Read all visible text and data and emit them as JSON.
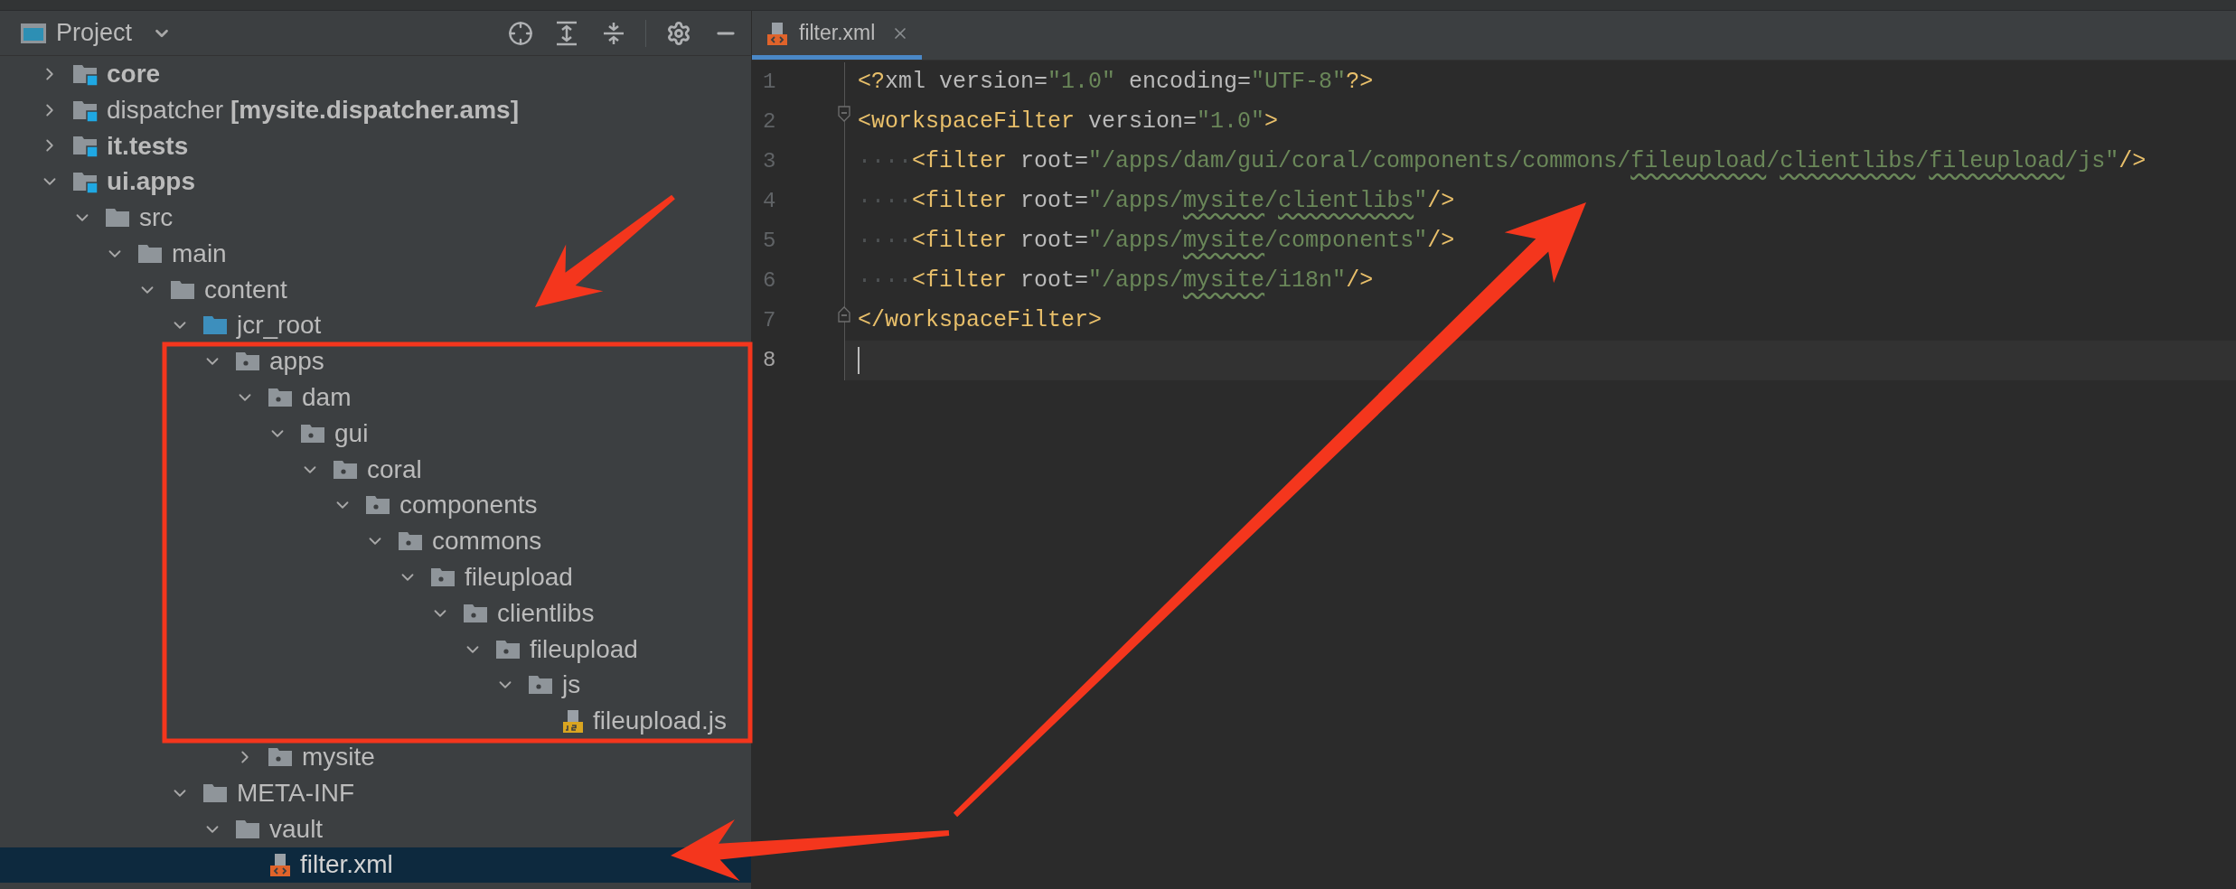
{
  "project_panel": {
    "title": "Project",
    "tree": [
      {
        "name": "core",
        "kind": "module",
        "bold": true,
        "expanded": false,
        "selected": false
      },
      {
        "name": "dispatcher **[mysite.dispatcher.ams]**",
        "kind": "module",
        "bold": false,
        "expanded": false,
        "selected": false
      },
      {
        "name": "it.tests",
        "kind": "module",
        "bold": true,
        "expanded": false,
        "selected": false
      },
      {
        "name": "ui.apps",
        "kind": "module",
        "bold": true,
        "expanded": true,
        "selected": false,
        "children": [
          {
            "name": "src",
            "kind": "folder",
            "bold": false,
            "expanded": true,
            "selected": false,
            "children": [
              {
                "name": "main",
                "kind": "folder",
                "bold": false,
                "expanded": true,
                "selected": false,
                "children": [
                  {
                    "name": "content",
                    "kind": "folder",
                    "bold": false,
                    "expanded": true,
                    "selected": false,
                    "children": [
                      {
                        "name": "jcr_root",
                        "kind": "source_root",
                        "bold": false,
                        "expanded": true,
                        "selected": false,
                        "children": [
                          {
                            "name": "apps",
                            "kind": "package",
                            "bold": false,
                            "expanded": true,
                            "selected": false,
                            "children": [
                              {
                                "name": "dam",
                                "kind": "package",
                                "bold": false,
                                "expanded": true,
                                "selected": false,
                                "children": [
                                  {
                                    "name": "gui",
                                    "kind": "package",
                                    "bold": false,
                                    "expanded": true,
                                    "selected": false,
                                    "children": [
                                      {
                                        "name": "coral",
                                        "kind": "package",
                                        "bold": false,
                                        "expanded": true,
                                        "selected": false,
                                        "children": [
                                          {
                                            "name": "components",
                                            "kind": "package",
                                            "bold": false,
                                            "expanded": true,
                                            "selected": false,
                                            "children": [
                                              {
                                                "name": "commons",
                                                "kind": "package",
                                                "bold": false,
                                                "expanded": true,
                                                "selected": false,
                                                "children": [
                                                  {
                                                    "name": "fileupload",
                                                    "kind": "package",
                                                    "bold": false,
                                                    "expanded": true,
                                                    "selected": false,
                                                    "children": [
                                                      {
                                                        "name": "clientlibs",
                                                        "kind": "package",
                                                        "bold": false,
                                                        "expanded": true,
                                                        "selected": false,
                                                        "children": [
                                                          {
                                                            "name": "fileupload",
                                                            "kind": "package",
                                                            "bold": false,
                                                            "expanded": true,
                                                            "selected": false,
                                                            "children": [
                                                              {
                                                                "name": "js",
                                                                "kind": "package",
                                                                "bold": false,
                                                                "expanded": true,
                                                                "selected": false,
                                                                "children": [
                                                                  {
                                                                    "name": "fileupload.js",
                                                                    "kind": "js_file",
                                                                    "bold": false,
                                                                    "selected": false
                                                                  }
                                                                ]
                                                              }
                                                            ]
                                                          }
                                                        ]
                                                      }
                                                    ]
                                                  }
                                                ]
                                              }
                                            ]
                                          }
                                        ]
                                      }
                                    ]
                                  }
                                ]
                              },
                              {
                                "name": "mysite",
                                "kind": "package",
                                "bold": false,
                                "expanded": false,
                                "selected": false
                              }
                            ]
                          }
                        ]
                      },
                      {
                        "name": "META-INF",
                        "kind": "folder",
                        "bold": false,
                        "expanded": true,
                        "selected": false,
                        "children": [
                          {
                            "name": "vault",
                            "kind": "folder",
                            "bold": false,
                            "expanded": true,
                            "selected": false,
                            "children": [
                              {
                                "name": "filter.xml",
                                "kind": "xml_file",
                                "bold": false,
                                "selected": true
                              }
                            ]
                          }
                        ]
                      }
                    ]
                  }
                ]
              }
            ]
          }
        ]
      }
    ]
  },
  "editor": {
    "tabs": [
      {
        "label": "filter.xml",
        "selected": true
      }
    ],
    "lines": [
      {
        "number": "1",
        "current": false,
        "fold_open": false,
        "fold_close": false,
        "tokens": [
          {
            "kind": "tag",
            "text": "<?",
            "typo": false
          },
          {
            "kind": "attr",
            "text": "xml version=",
            "typo": false
          },
          {
            "kind": "string",
            "text": "\"1.0\"",
            "typo": false
          },
          {
            "kind": "attr",
            "text": " encoding=",
            "typo": false
          },
          {
            "kind": "string",
            "text": "\"UTF-8\"",
            "typo": false
          },
          {
            "kind": "tag",
            "text": "?>",
            "typo": false
          }
        ]
      },
      {
        "number": "2",
        "current": false,
        "fold_open": true,
        "fold_close": false,
        "tokens": [
          {
            "kind": "tag",
            "text": "<workspaceFilter",
            "typo": false
          },
          {
            "kind": "attr",
            "text": " version=",
            "typo": false
          },
          {
            "kind": "string",
            "text": "\"1.0\"",
            "typo": false
          },
          {
            "kind": "tag",
            "text": ">",
            "typo": false
          }
        ]
      },
      {
        "number": "3",
        "current": false,
        "fold_open": false,
        "fold_close": false,
        "tokens": [
          {
            "kind": "whitespace",
            "text": "····",
            "typo": false
          },
          {
            "kind": "tag",
            "text": "<filter",
            "typo": false
          },
          {
            "kind": "attr",
            "text": " root=",
            "typo": false
          },
          {
            "kind": "string",
            "text": "\"/apps/dam/gui/coral/components/commons/",
            "typo": false
          },
          {
            "kind": "string",
            "text": "fileupload",
            "typo": true
          },
          {
            "kind": "string",
            "text": "/",
            "typo": false
          },
          {
            "kind": "string",
            "text": "clientlibs",
            "typo": true
          },
          {
            "kind": "string",
            "text": "/",
            "typo": false
          },
          {
            "kind": "string",
            "text": "fileupload",
            "typo": true
          },
          {
            "kind": "string",
            "text": "/js\"",
            "typo": false
          },
          {
            "kind": "tag",
            "text": "/>",
            "typo": false
          }
        ]
      },
      {
        "number": "4",
        "current": false,
        "fold_open": false,
        "fold_close": false,
        "tokens": [
          {
            "kind": "whitespace",
            "text": "····",
            "typo": false
          },
          {
            "kind": "tag",
            "text": "<filter",
            "typo": false
          },
          {
            "kind": "attr",
            "text": " root=",
            "typo": false
          },
          {
            "kind": "string",
            "text": "\"/apps/",
            "typo": false
          },
          {
            "kind": "string",
            "text": "mysite",
            "typo": true
          },
          {
            "kind": "string",
            "text": "/",
            "typo": false
          },
          {
            "kind": "string",
            "text": "clientlibs",
            "typo": true
          },
          {
            "kind": "string",
            "text": "\"",
            "typo": false
          },
          {
            "kind": "tag",
            "text": "/>",
            "typo": false
          }
        ]
      },
      {
        "number": "5",
        "current": false,
        "fold_open": false,
        "fold_close": false,
        "tokens": [
          {
            "kind": "whitespace",
            "text": "····",
            "typo": false
          },
          {
            "kind": "tag",
            "text": "<filter",
            "typo": false
          },
          {
            "kind": "attr",
            "text": " root=",
            "typo": false
          },
          {
            "kind": "string",
            "text": "\"/apps/",
            "typo": false
          },
          {
            "kind": "string",
            "text": "mysite",
            "typo": true
          },
          {
            "kind": "string",
            "text": "/components\"",
            "typo": false
          },
          {
            "kind": "tag",
            "text": "/>",
            "typo": false
          }
        ]
      },
      {
        "number": "6",
        "current": false,
        "fold_open": false,
        "fold_close": false,
        "tokens": [
          {
            "kind": "whitespace",
            "text": "····",
            "typo": false
          },
          {
            "kind": "tag",
            "text": "<filter",
            "typo": false
          },
          {
            "kind": "attr",
            "text": " root=",
            "typo": false
          },
          {
            "kind": "string",
            "text": "\"/apps/",
            "typo": false
          },
          {
            "kind": "string",
            "text": "mysite",
            "typo": true
          },
          {
            "kind": "string",
            "text": "/i18n\"",
            "typo": false
          },
          {
            "kind": "tag",
            "text": "/>",
            "typo": false
          }
        ]
      },
      {
        "number": "7",
        "current": false,
        "fold_open": false,
        "fold_close": true,
        "tokens": [
          {
            "kind": "tag",
            "text": "</workspaceFilter>",
            "typo": false
          }
        ]
      },
      {
        "number": "8",
        "current": true,
        "fold_open": false,
        "fold_close": false
      }
    ]
  }
}
